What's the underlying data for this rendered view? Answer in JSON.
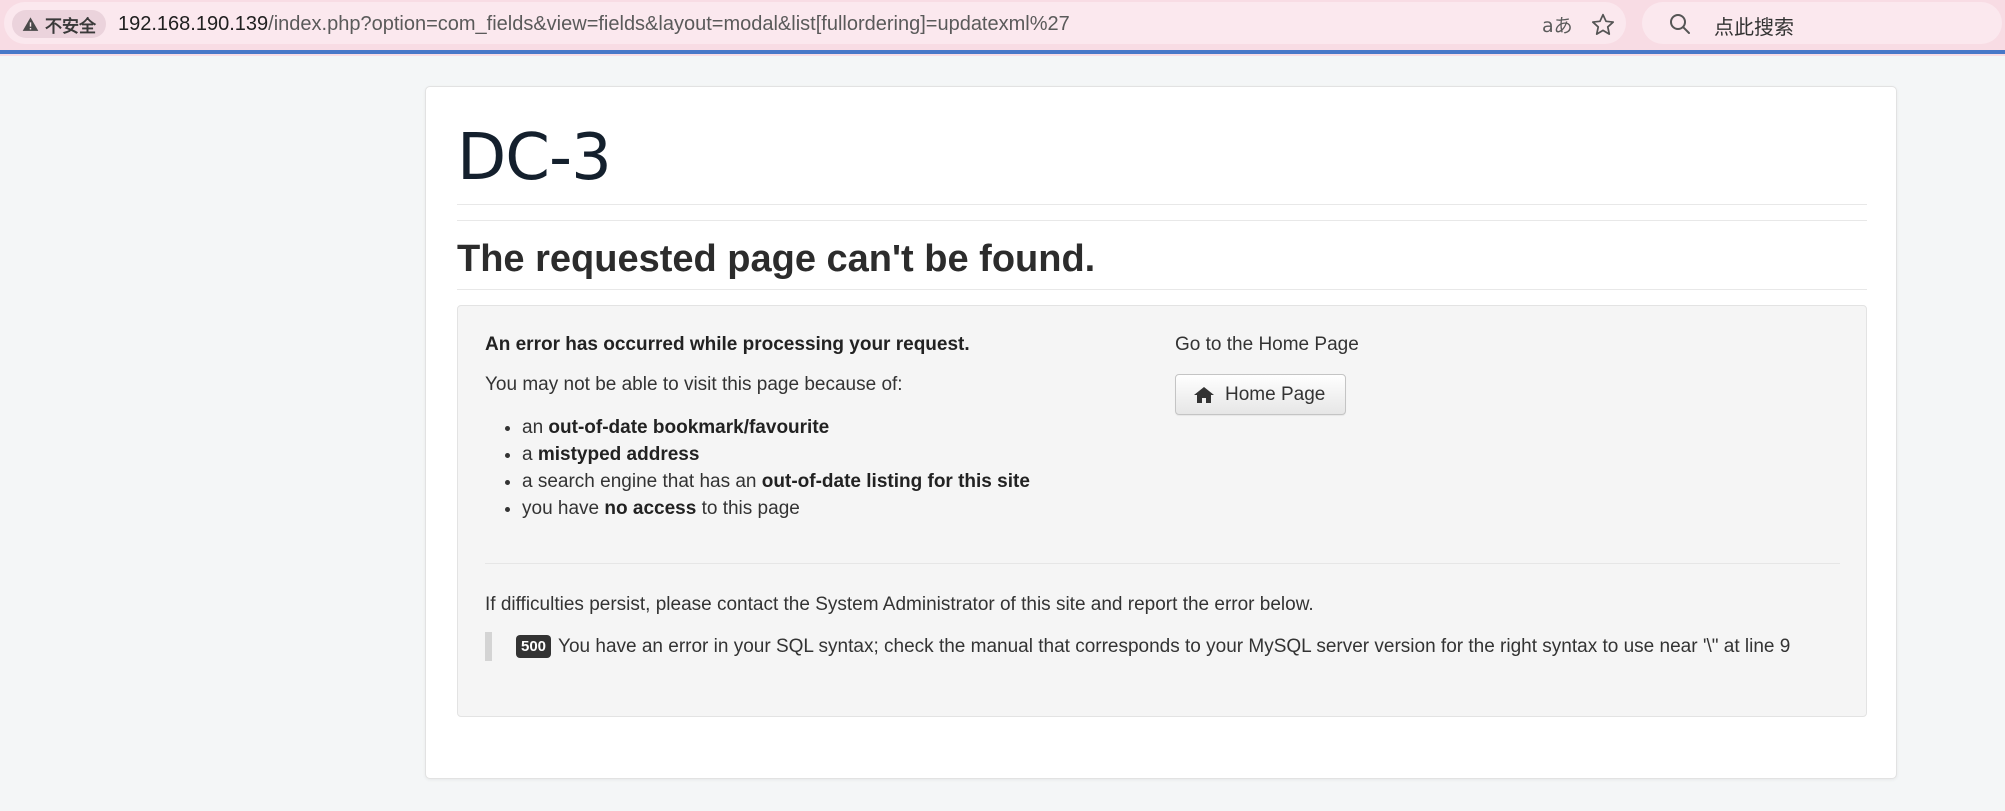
{
  "browser": {
    "security_label": "不安全",
    "url_host": "192.168.190.139",
    "url_path": "/index.php?option=com_fields&view=fields&layout=modal&list[fullordering]=updatexml%27",
    "translate_glyph": "aあ",
    "search_placeholder": "点此搜索",
    "icons": [
      "warning-icon",
      "translate-icon",
      "star-icon",
      "search-icon"
    ]
  },
  "page": {
    "site_title": "DC-3",
    "heading": "The requested page can't be found.",
    "error_title": "An error has occurred while processing your request.",
    "intro": "You may not be able to visit this page because of:",
    "reasons": [
      {
        "pre": "an ",
        "bold": "out-of-date bookmark/favourite",
        "post": ""
      },
      {
        "pre": "a ",
        "bold": "mistyped address",
        "post": ""
      },
      {
        "pre": "a search engine that has an ",
        "bold": "out-of-date listing for this site",
        "post": ""
      },
      {
        "pre": "you have ",
        "bold": "no access",
        "post": " to this page"
      }
    ],
    "home_label": "Go to the Home Page",
    "home_button": "Home Page",
    "contact_text": "If difficulties persist, please contact the System Administrator of this site and report the error below.",
    "error_code": "500",
    "error_message": "You have an error in your SQL syntax; check the manual that corresponds to your MySQL server version for the right syntax to use near '\\\" at line 9"
  },
  "colors": {
    "browser_bar": "#f8dce4",
    "accent_line": "#4878c8",
    "page_bg": "#f4f6f7",
    "badge_bg": "#333333"
  }
}
